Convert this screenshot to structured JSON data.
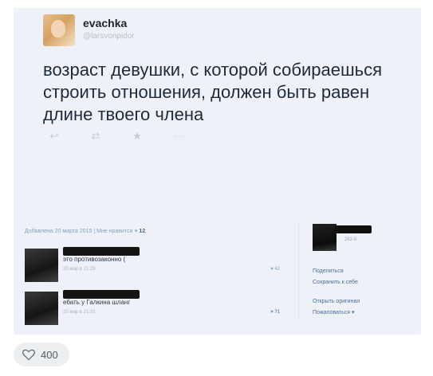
{
  "tweet": {
    "username": "evachka",
    "handle": "@larsvonpidor",
    "text": "возраст девушки, с которой собираешься строить отношения, должен быть равен длине твоего члена",
    "actions": [
      "reply-icon",
      "retweet-icon",
      "star-icon",
      "more-icon"
    ]
  },
  "post": {
    "meta_text": "Добавлена 20 марта 2015  |  Мне нравится",
    "likes": "12"
  },
  "comments": [
    {
      "text": "это противозаконно (",
      "date": "20 мар в 21:25",
      "likes": "42"
    },
    {
      "text": "ебать у Галкина шланг",
      "date": "20 мар в 21:31",
      "likes": "71"
    }
  ],
  "sidebar": {
    "photo_label": "262-й",
    "links": [
      "Поделиться",
      "Сохранить к себе",
      "Открыть оригинал",
      "Пожаловаться ▾"
    ]
  },
  "footer": {
    "likes": "400"
  },
  "colors": {
    "card_bg": "#eef1f7",
    "link": "#4e6e94"
  }
}
